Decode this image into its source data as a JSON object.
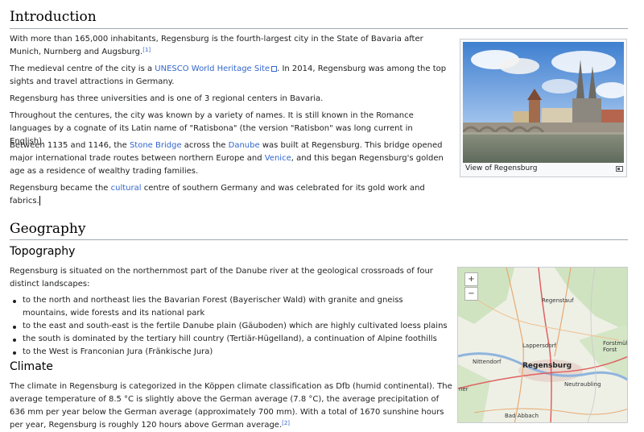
{
  "intro": {
    "heading": "Introduction",
    "p1": {
      "text": "With more than 165,000 inhabitants, Regensburg is the fourth-largest city in the State of Bavaria after Munich, Nurnberg and Augsburg.",
      "ref": "[1]"
    },
    "p2": {
      "before": "The medieval centre of the city is a ",
      "link": "UNESCO World Heritage Site",
      "after": ". In 2014, Regensburg was among the top sights and travel attractions in Germany."
    },
    "p3": "Regensburg has three universities and is one of 3 regional centers in Bavaria.",
    "p4": "Throughout the centures, the city was known by a variety of names. It is still known in the Romance languages by a cognate of its Latin name of \"Ratisbona\" (the version \"Ratisbon\" was long current in English).",
    "p5": {
      "t1": "Between 1135 and 1146, the ",
      "l1": "Stone Bridge",
      "t2": " across the ",
      "l2": "Danube",
      "t3": " was built at Regensburg. This bridge opened major international trade routes between northern Europe and ",
      "l3": "Venice",
      "t4": ", and this began Regensburg's golden age as a residence of wealthy trading families."
    },
    "p6": {
      "t1": "Regensburg became the ",
      "l1": "cultural",
      "t2": " centre of southern Germany and was celebrated for its gold work and fabrics."
    },
    "image_caption": "View of Regensburg"
  },
  "geography": {
    "heading": "Geography",
    "topography": {
      "heading": "Topography",
      "intro": "Regensburg is situated on the northernmost part of the Danube river at the geological crossroads of four distinct landscapes:",
      "items": [
        "to the north and northeast lies the Bavarian Forest (Bayerischer Wald) with granite and gneiss mountains, wide forests and its national park",
        "to the east and south-east is the fertile Danube plain (Gäuboden) which are highly cultivated loess plains",
        "the south is dominated by the tertiary hill country (Tertiär-Hügelland), a continuation of Alpine foothills",
        "to the West is Franconian Jura (Fränkische Jura)"
      ]
    },
    "climate": {
      "heading": "Climate",
      "text": "The climate in Regensburg is categorized in the Köppen climate classification as Dfb (humid continental). The average temperature of 8.5 °C is slightly above the German average (7.8 °C), the average precipitation of 636 mm per year below the German average (approximately 700 mm). With a total of 1670 sunshine hours per year, Regensburg is roughly 120 hours above German average.",
      "ref": "[2]"
    },
    "map": {
      "zoom_in": "+",
      "zoom_out": "−",
      "labels": {
        "regenstauf": "Regenstauf",
        "lappersdorf": "Lappersdorf",
        "forstmuhl": "Forstmühl Forst",
        "nittendorf": "Nittendorf",
        "regensburg": "Regensburg",
        "neutraubling": "Neutraubling",
        "bad_abbach": "Bad Abbach",
        "edge": "ner"
      }
    }
  }
}
